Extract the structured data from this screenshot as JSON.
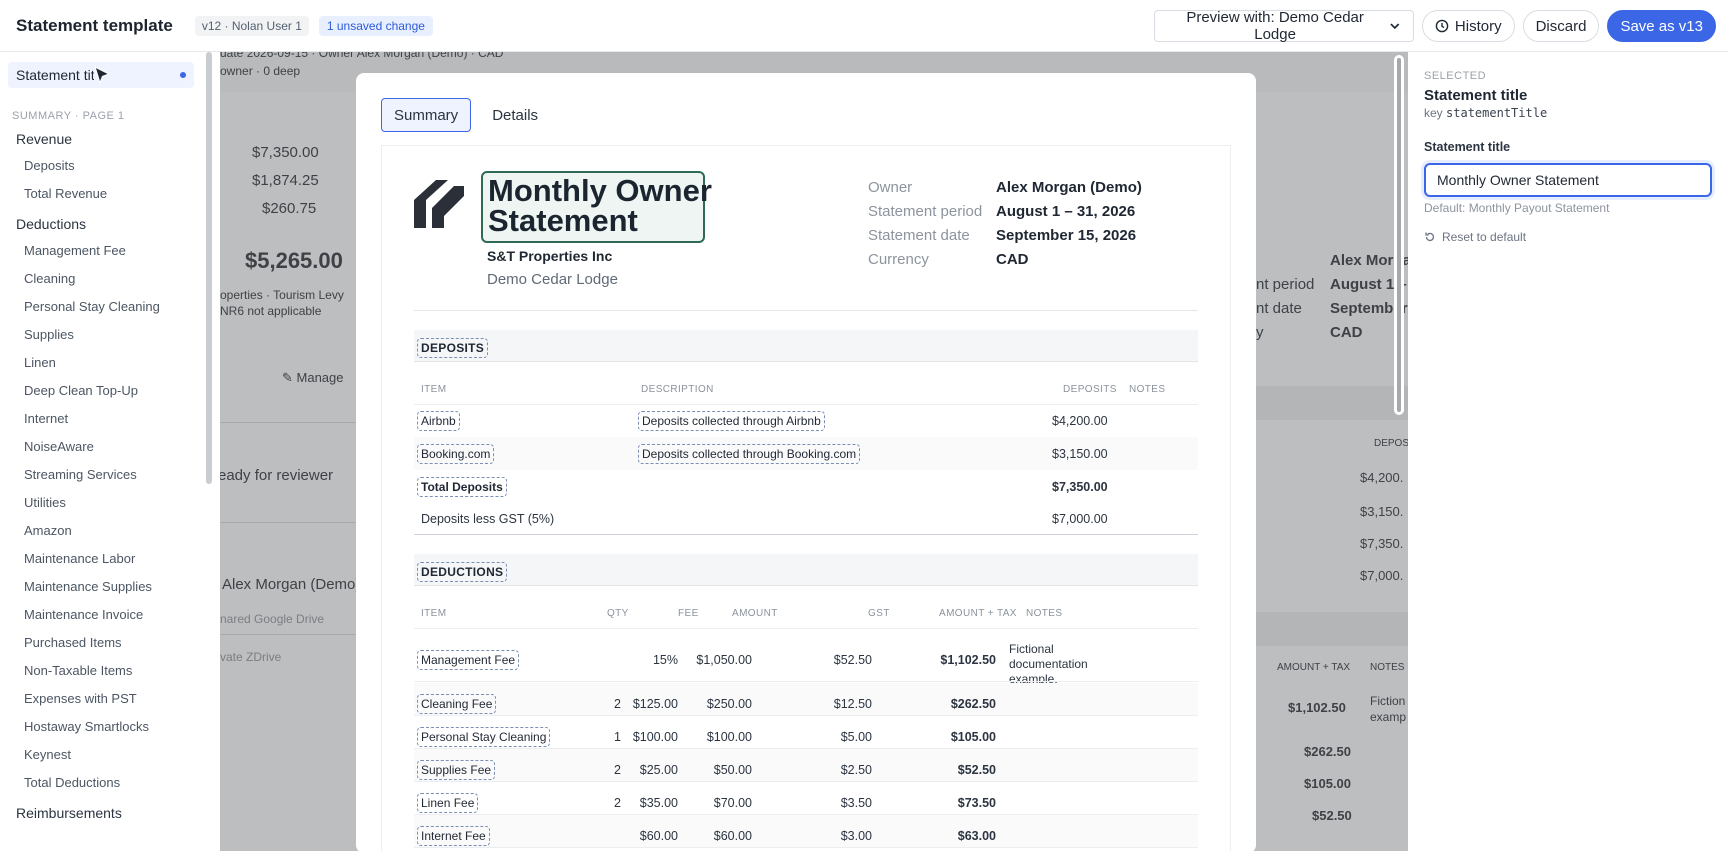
{
  "header": {
    "title": "Statement template",
    "version": "v12 · Nolan User 1",
    "unsaved": "1 unsaved change",
    "preview_label": "Preview with: Demo Cedar Lodge",
    "history_label": "History",
    "discard_label": "Discard",
    "save_label": "Save as v13"
  },
  "sidebar": {
    "selected": "Statement title",
    "section": "SUMMARY · PAGE 1",
    "items": [
      {
        "label": "Revenue",
        "type": "group"
      },
      {
        "label": "Deposits",
        "type": "sub"
      },
      {
        "label": "Total Revenue",
        "type": "sub"
      },
      {
        "label": "Deductions",
        "type": "group"
      },
      {
        "label": "Management Fee",
        "type": "sub"
      },
      {
        "label": "Cleaning",
        "type": "sub"
      },
      {
        "label": "Personal Stay Cleaning",
        "type": "sub"
      },
      {
        "label": "Supplies",
        "type": "sub"
      },
      {
        "label": "Linen",
        "type": "sub"
      },
      {
        "label": "Deep Clean Top-Up",
        "type": "sub"
      },
      {
        "label": "Internet",
        "type": "sub"
      },
      {
        "label": "NoiseAware",
        "type": "sub"
      },
      {
        "label": "Streaming Services",
        "type": "sub"
      },
      {
        "label": "Utilities",
        "type": "sub"
      },
      {
        "label": "Amazon",
        "type": "sub"
      },
      {
        "label": "Maintenance Labor",
        "type": "sub"
      },
      {
        "label": "Maintenance Supplies",
        "type": "sub"
      },
      {
        "label": "Maintenance Invoice",
        "type": "sub"
      },
      {
        "label": "Purchased Items",
        "type": "sub"
      },
      {
        "label": "Non-Taxable Items",
        "type": "sub"
      },
      {
        "label": "Expenses with PST",
        "type": "sub"
      },
      {
        "label": "Hostaway Smartlocks",
        "type": "sub"
      },
      {
        "label": "Keynest",
        "type": "sub"
      },
      {
        "label": "Total Deductions",
        "type": "sub"
      },
      {
        "label": "Reimbursements",
        "type": "group"
      }
    ]
  },
  "background": {
    "frag_top1": "date 2026-09-15 · Owner Alex Morgan (Demo) · CAD",
    "frag_top2": "owner · 0 deep",
    "amt1": "$7,350.00",
    "amt2": "$1,874.25",
    "amt3": "$260.75",
    "big_total": "$5,265.00",
    "note1": "operties · Tourism Levy",
    "note2": "NR6 not applicable",
    "manage": "Manage",
    "ready": "eady for reviewer",
    "owner_name": "Alex Morgan (Demo)",
    "link1": "nared Google Drive",
    "link2": "vate ZDrive",
    "r_owner": "Alex Morga",
    "r_period_l": "nt period",
    "r_period_v": "August 1 – 3",
    "r_date_l": "nt date",
    "r_date_v": "September",
    "r_cur_l": "y",
    "r_cur_v": "CAD",
    "r_dep_head": "DEPOS",
    "r_d1": "$4,200.",
    "r_d2": "$3,150.",
    "r_d3": "$7,350.",
    "r_d4": "$7,000.",
    "r_head_amt": "AMOUNT + TAX",
    "r_head_notes": "NOTES",
    "r_v1": "$1,102.50",
    "r_n1a": "Fiction",
    "r_n1b": "examp",
    "r_v2": "$262.50",
    "r_v3": "$105.00",
    "r_v4": "$52.50"
  },
  "modal": {
    "tabs": [
      {
        "label": "Summary"
      },
      {
        "label": "Details"
      }
    ],
    "statement_title": "Monthly Owner Statement",
    "company": "S&T Properties Inc",
    "property": "Demo Cedar Lodge",
    "meta": [
      {
        "label": "Owner",
        "value": "Alex Morgan (Demo)"
      },
      {
        "label": "Statement period",
        "value": "August 1 – 31, 2026"
      },
      {
        "label": "Statement date",
        "value": "September 15, 2026"
      },
      {
        "label": "Currency",
        "value": "CAD"
      }
    ],
    "deposits": {
      "title": "DEPOSITS",
      "headers": {
        "item": "ITEM",
        "description": "DESCRIPTION",
        "deposits": "DEPOSITS",
        "notes": "NOTES"
      },
      "rows": [
        {
          "item": "Airbnb",
          "description": "Deposits collected through Airbnb",
          "amount": "$4,200.00"
        },
        {
          "item": "Booking.com",
          "description": "Deposits collected through Booking.com",
          "amount": "$3,150.00"
        }
      ],
      "total_label": "Total Deposits",
      "total_value": "$7,350.00",
      "less_label": "Deposits less GST (5%)",
      "less_value": "$7,000.00"
    },
    "deductions": {
      "title": "DEDUCTIONS",
      "headers": {
        "item": "ITEM",
        "qty": "QTY",
        "fee": "FEE",
        "amount": "AMOUNT",
        "gst": "GST",
        "amount_tax": "AMOUNT + TAX",
        "notes": "NOTES"
      },
      "rows": [
        {
          "item": "Management Fee",
          "qty": "",
          "fee": "15%",
          "amount": "$1,050.00",
          "gst": "$52.50",
          "total": "$1,102.50",
          "notes": [
            "Fictional",
            "documentation",
            "example."
          ]
        },
        {
          "item": "Cleaning Fee",
          "qty": "2",
          "fee": "$125.00",
          "amount": "$250.00",
          "gst": "$12.50",
          "total": "$262.50",
          "notes": []
        },
        {
          "item": "Personal Stay Cleaning",
          "qty": "1",
          "fee": "$100.00",
          "amount": "$100.00",
          "gst": "$5.00",
          "total": "$105.00",
          "notes": []
        },
        {
          "item": "Supplies Fee",
          "qty": "2",
          "fee": "$25.00",
          "amount": "$50.00",
          "gst": "$2.50",
          "total": "$52.50",
          "notes": []
        },
        {
          "item": "Linen Fee",
          "qty": "2",
          "fee": "$35.00",
          "amount": "$70.00",
          "gst": "$3.50",
          "total": "$73.50",
          "notes": []
        },
        {
          "item": "Internet Fee",
          "qty": "",
          "fee": "$60.00",
          "amount": "$60.00",
          "gst": "$3.00",
          "total": "$63.00",
          "notes": []
        }
      ]
    }
  },
  "inspector": {
    "selected_label": "SELECTED",
    "title": "Statement title",
    "key_prefix": "key",
    "key": "statementTitle",
    "field_label": "Statement title",
    "value": "Monthly Owner Statement",
    "default_text": "Default: Monthly Payout Statement",
    "reset_label": "Reset to default"
  },
  "colors": {
    "accent": "#3b66e6",
    "title_border": "#2f6b54"
  }
}
